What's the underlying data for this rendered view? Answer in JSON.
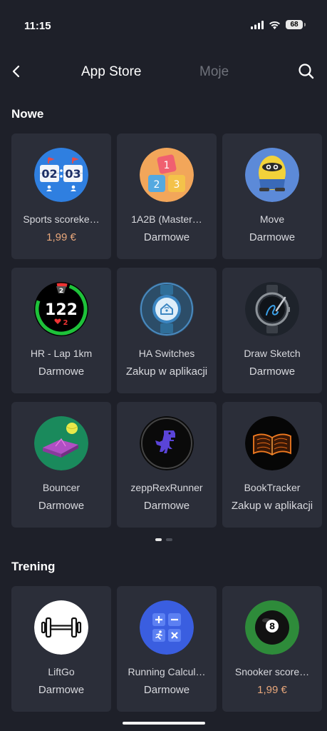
{
  "status_bar": {
    "time": "11:15",
    "battery": "68"
  },
  "header": {
    "tab_store": "App Store",
    "tab_mine": "Moje"
  },
  "sections": {
    "new": {
      "title": "Nowe",
      "apps": [
        {
          "name": "Sports scoreke…",
          "price": "1,99 €"
        },
        {
          "name": "1A2B (Master…",
          "price": "Darmowe"
        },
        {
          "name": "Move",
          "price": "Darmowe"
        },
        {
          "name": "HR - Lap 1km",
          "price": "Darmowe"
        },
        {
          "name": "HA Switches",
          "price": "Zakup w aplikacji"
        },
        {
          "name": "Draw Sketch",
          "price": "Darmowe"
        },
        {
          "name": "Bouncer",
          "price": "Darmowe"
        },
        {
          "name": "zeppRexRunner",
          "price": "Darmowe"
        },
        {
          "name": "BookTracker",
          "price": "Zakup w aplikacji"
        }
      ]
    },
    "training": {
      "title": "Trening",
      "apps": [
        {
          "name": "LiftGo",
          "price": "Darmowe"
        },
        {
          "name": "Running Calcul…",
          "price": "Darmowe"
        },
        {
          "name": "Snooker score…",
          "price": "1,99 €"
        }
      ]
    }
  },
  "icon_text": {
    "sports_left": "02",
    "sports_right": "03",
    "tiles": [
      "1",
      "2",
      "3"
    ],
    "hr_lap": "2",
    "hr_value": "122",
    "hr_hearts": "2",
    "snooker_ball": "8"
  },
  "pagination": {
    "pages": 2,
    "active": 1
  },
  "colors": {
    "background": "#1e2029",
    "card": "#2b2e39",
    "price_paid": "#e8a77b",
    "text": "#d8d9de"
  }
}
